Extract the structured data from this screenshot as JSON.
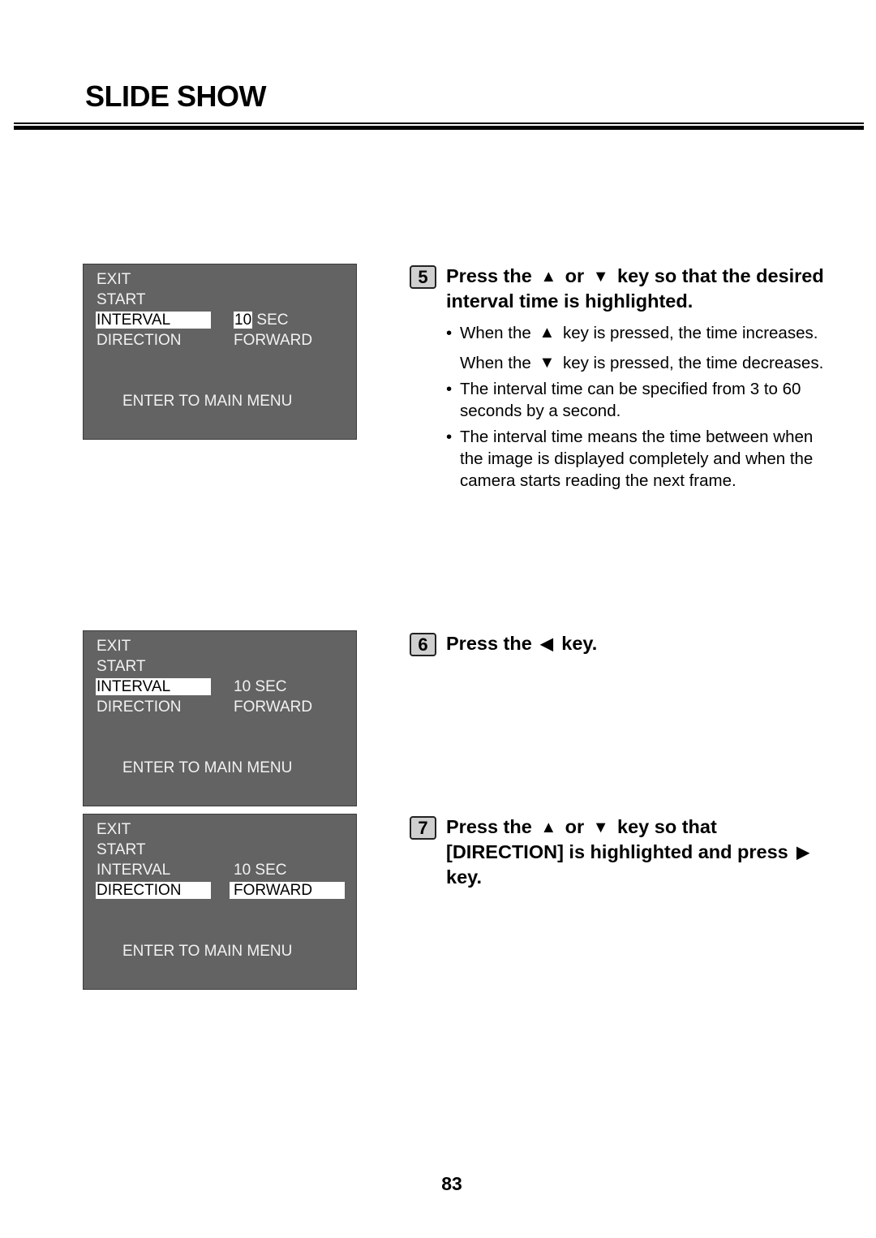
{
  "page": {
    "title": "SLIDE SHOW",
    "page_number": "83"
  },
  "screens": [
    {
      "rows": [
        {
          "label": "EXIT"
        },
        {
          "label": "START"
        },
        {
          "label": "INTERVAL",
          "value_num": "10",
          "value_unit": "SEC"
        },
        {
          "label": "DIRECTION",
          "value": "FORWARD"
        }
      ],
      "footer": "ENTER TO MAIN MENU",
      "highlighted_label": "INTERVAL",
      "highlighted_value": "10"
    },
    {
      "rows": [
        {
          "label": "EXIT"
        },
        {
          "label": "START"
        },
        {
          "label": "INTERVAL",
          "value": "10 SEC"
        },
        {
          "label": "DIRECTION",
          "value": "FORWARD"
        }
      ],
      "footer": "ENTER TO MAIN MENU",
      "highlighted_label": "INTERVAL"
    },
    {
      "rows": [
        {
          "label": "EXIT"
        },
        {
          "label": "START"
        },
        {
          "label": "INTERVAL",
          "value": "10 SEC"
        },
        {
          "label": "DIRECTION",
          "value": "FORWARD"
        }
      ],
      "footer": "ENTER TO MAIN MENU",
      "highlighted_label": "DIRECTION",
      "highlighted_value": "FORWARD"
    }
  ],
  "steps": [
    {
      "number": "5",
      "heading": {
        "part1": "Press the",
        "up_icon": "▲",
        "part2": "or",
        "down_icon": "▼",
        "part3": "key so that the desired interval time is highlighted."
      },
      "bullets": [
        {
          "text_a": "When the",
          "icon": "▲",
          "text_b": "key is pressed, the time increases.",
          "continuation": {
            "text_a": "When the",
            "icon": "▼",
            "text_b": "key is pressed, the time decreases."
          }
        },
        {
          "text": "The interval time can be specified from 3 to 60 seconds by a second."
        },
        {
          "text": "The interval time means the time between when the image is displayed completely and when the camera starts reading the next frame."
        }
      ],
      "bullet_glyph": "•"
    },
    {
      "number": "6",
      "heading": {
        "part1": "Press the",
        "left_icon": "◀",
        "part2": "key."
      }
    },
    {
      "number": "7",
      "heading": {
        "part1": "Press the",
        "up_icon": "▲",
        "part2": "or",
        "down_icon": "▼",
        "part3": "key so that [DIRECTION] is highlighted and press",
        "right_icon": "▶",
        "part4": "key."
      }
    }
  ]
}
